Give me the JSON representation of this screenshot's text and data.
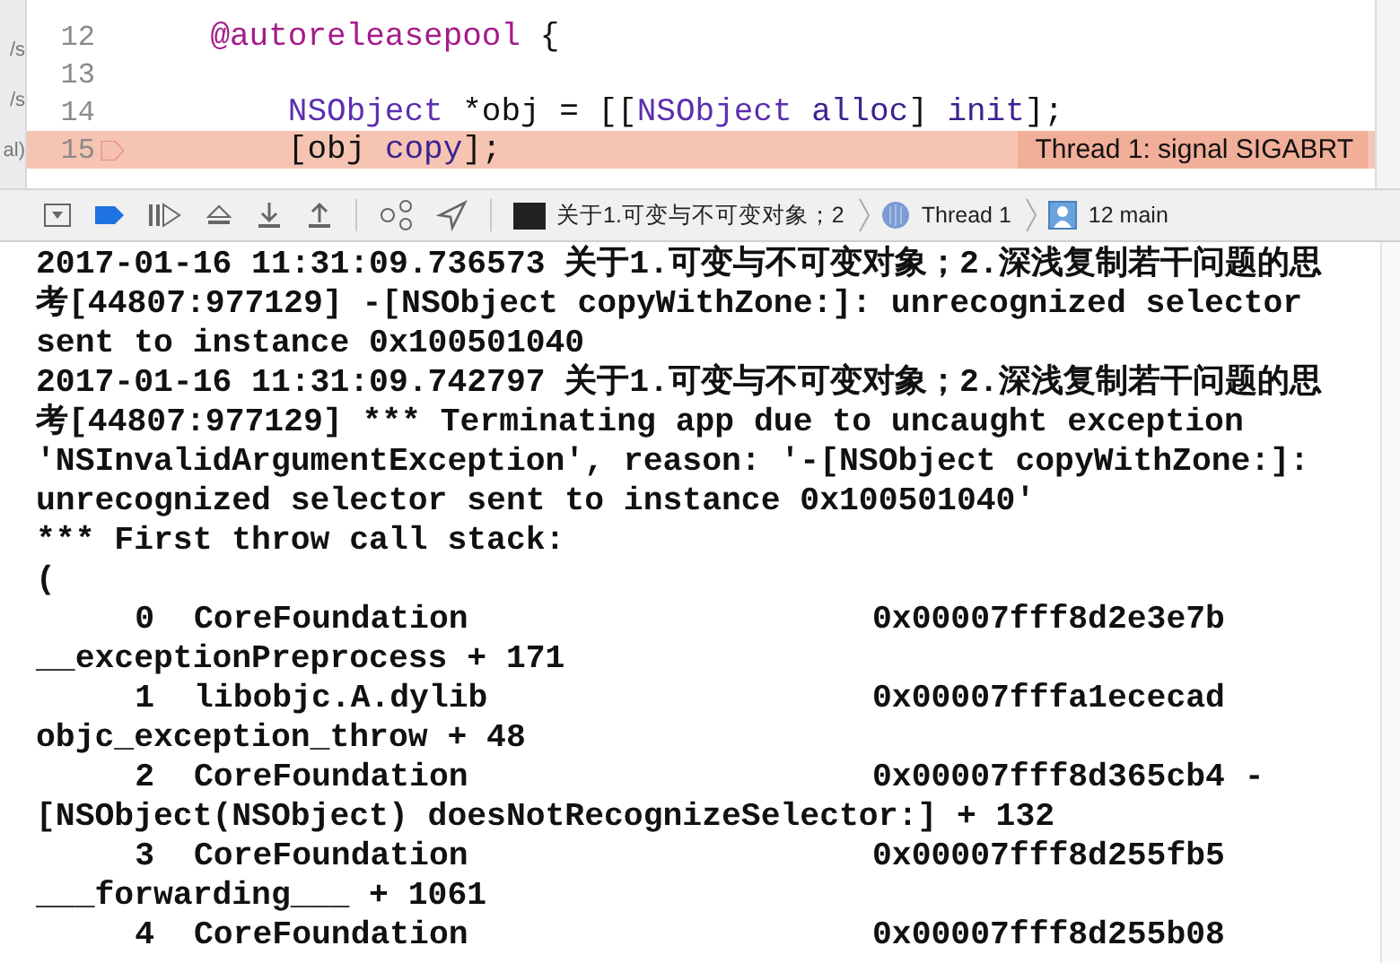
{
  "side_fragments": [
    "/s",
    "/s",
    "al)"
  ],
  "editor": {
    "lines": [
      {
        "number": "12",
        "error": false,
        "tokens": [
          {
            "kind": "keyword",
            "text": "    @autoreleasepool"
          },
          {
            "kind": "plain",
            "text": " {"
          }
        ]
      },
      {
        "number": "13",
        "error": false
      },
      {
        "number": "14",
        "error": false,
        "tokens": [
          {
            "kind": "type",
            "text": "        NSObject"
          },
          {
            "kind": "plain",
            "text": " *obj = [["
          },
          {
            "kind": "type",
            "text": "NSObject"
          },
          {
            "kind": "method",
            "text": " alloc"
          },
          {
            "kind": "plain",
            "text": "] "
          },
          {
            "kind": "method",
            "text": "init"
          },
          {
            "kind": "plain",
            "text": "];"
          }
        ]
      },
      {
        "number": "15",
        "error": true,
        "message": "Thread 1: signal SIGABRT",
        "tokens": [
          {
            "kind": "plain",
            "text": "        [obj "
          },
          {
            "kind": "method",
            "text": "copy"
          },
          {
            "kind": "plain",
            "text": "];"
          }
        ]
      }
    ]
  },
  "debug_bar": {
    "process": "关于1.可变与不可变对象；2",
    "thread": "Thread 1",
    "frame": "12 main"
  },
  "console": {
    "messages": [
      "2017-01-16 11:31:09.736573 关于1.可变与不可变对象；2.深浅复制若干问题的思",
      "考[44807:977129] -[NSObject copyWithZone:]: unrecognized selector",
      "sent to instance 0x100501040",
      "2017-01-16 11:31:09.742797 关于1.可变与不可变对象；2.深浅复制若干问题的思",
      "考[44807:977129] *** Terminating app due to uncaught exception",
      "'NSInvalidArgumentException', reason: '-[NSObject copyWithZone:]:",
      "unrecognized selector sent to instance 0x100501040'",
      "*** First throw call stack:",
      "("
    ],
    "frames": [
      {
        "index": "0",
        "library": "CoreFoundation",
        "address": "0x00007fff8d2e3e7b",
        "symbol": "__exceptionPreprocess + 171"
      },
      {
        "index": "1",
        "library": "libobjc.A.dylib",
        "address": "0x00007fffa1ececad",
        "symbol": "objc_exception_throw + 48"
      },
      {
        "index": "2",
        "library": "CoreFoundation",
        "address": "0x00007fff8d365cb4 -",
        "symbol": "[NSObject(NSObject) doesNotRecognizeSelector:] + 132"
      },
      {
        "index": "3",
        "library": "CoreFoundation",
        "address": "0x00007fff8d255fb5",
        "symbol": "___forwarding___ + 1061"
      },
      {
        "index": "4",
        "library": "CoreFoundation",
        "address": "0x00007fff8d255b08"
      }
    ]
  }
}
